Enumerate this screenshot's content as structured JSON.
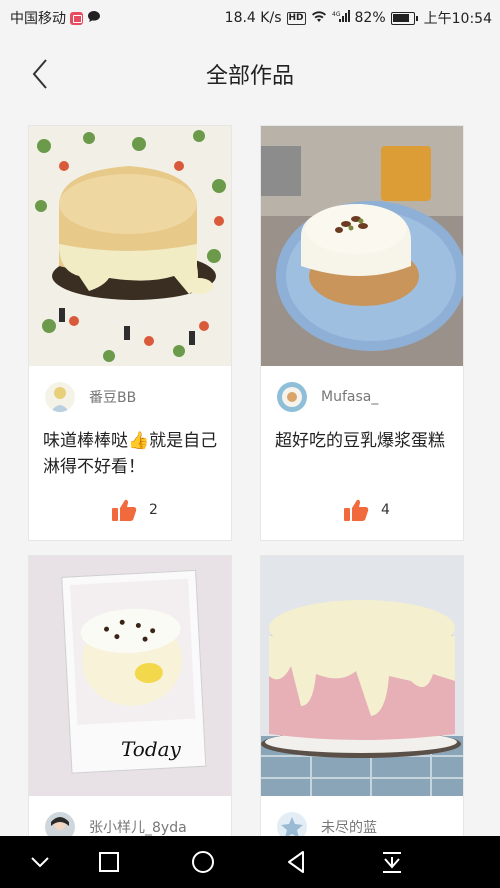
{
  "status_bar": {
    "carrier": "中国移动",
    "speed": "18.4 K/s",
    "hd": "HD",
    "network": "4G",
    "battery": "82%",
    "time": "上午10:54"
  },
  "header": {
    "title": "全部作品"
  },
  "works": [
    {
      "author": "番豆BB",
      "caption": "味道棒棒哒👍就是自己淋得不好看！",
      "likes": "2"
    },
    {
      "author": "Mufasa_",
      "caption": "超好吃的豆乳爆浆蛋糕",
      "likes": "4"
    },
    {
      "author": "张小样儿_8yda",
      "photo_text": "Today",
      "caption": "",
      "likes": ""
    },
    {
      "author": "未尽的蓝",
      "caption": "",
      "likes": ""
    }
  ],
  "colors": {
    "accent": "#f06a3e",
    "background": "#f4f4f4"
  },
  "icons": {
    "back": "chevron-left-icon",
    "like": "thumbs-up-icon",
    "nav": [
      "chevron-down-icon",
      "square-icon",
      "circle-icon",
      "triangle-back-icon",
      "download-icon"
    ]
  }
}
